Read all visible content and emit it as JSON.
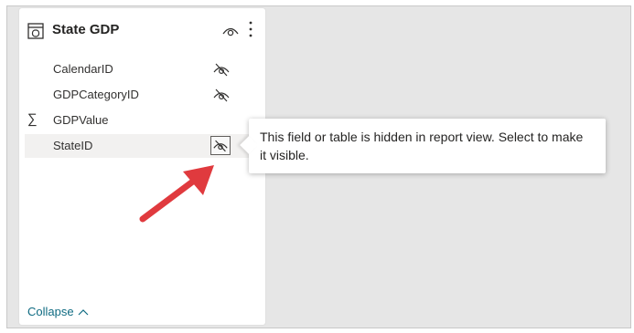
{
  "card": {
    "title": "State GDP",
    "fields": [
      {
        "label": "CalendarID",
        "hidden": true,
        "aggregate": false
      },
      {
        "label": "GDPCategoryID",
        "hidden": true,
        "aggregate": false
      },
      {
        "label": "GDPValue",
        "hidden": false,
        "aggregate": true,
        "aggregate_symbol": "∑"
      },
      {
        "label": "StateID",
        "hidden": true,
        "aggregate": false,
        "hovered": true
      }
    ],
    "collapse_label": "Collapse",
    "collapse_glyph": "^"
  },
  "tooltip": {
    "text": "This field or table is hidden in report view. Select to make it visible."
  },
  "colors": {
    "canvas": "#e6e6e6",
    "card": "#ffffff",
    "collapse_link": "#0f6b82",
    "annotation_arrow": "#e03a3e"
  },
  "icons": {
    "table": "table-icon",
    "visible": "eye-icon",
    "more": "more-vertical-icon",
    "hidden": "eye-slash-icon"
  }
}
